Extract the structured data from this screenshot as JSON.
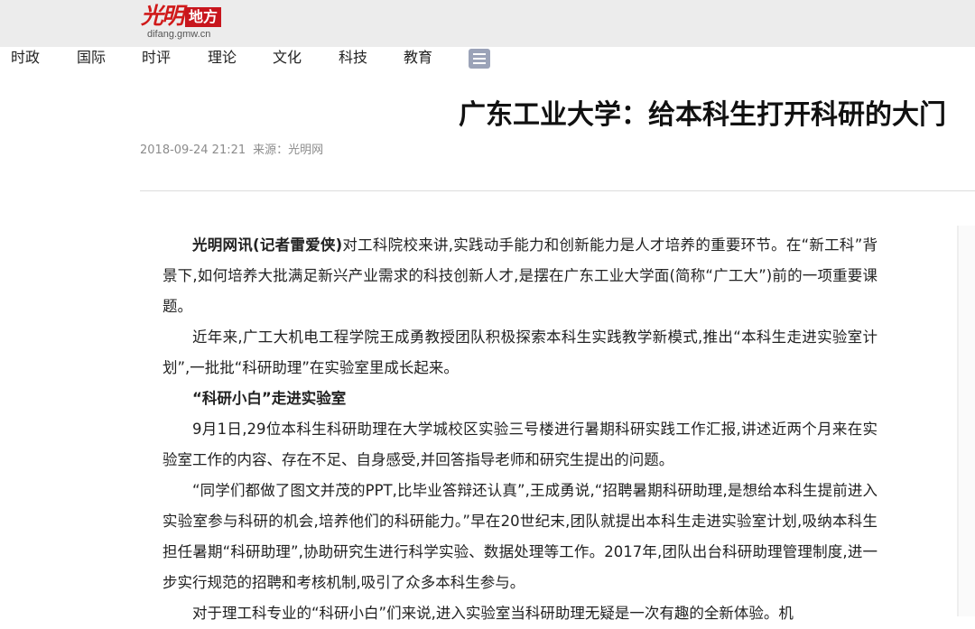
{
  "header": {
    "logo_script": "光明",
    "logo_box": "地方",
    "logo_url": "difang.gmw.cn"
  },
  "nav": {
    "items": [
      "时政",
      "国际",
      "时评",
      "理论",
      "文化",
      "科技",
      "教育"
    ],
    "menu_icon": "list-menu-icon"
  },
  "article": {
    "title": "广东工业大学：给本科生打开科研的大门",
    "date": "2018-09-24 21:21",
    "source": "来源：光明网",
    "lead": "光明网讯(记者雷爱侠)",
    "p1_rest": "对工科院校来讲,实践动手能力和创新能力是人才培养的重要环节。在“新工科”背景下,如何培养大批满足新兴产业需求的科技创新人才,是摆在广东工业大学面(简称“广工大”)前的一项重要课题。",
    "p2": "近年来,广工大机电工程学院王成勇教授团队积极探索本科生实践教学新模式,推出“本科生走进实验室计划”,一批批“科研助理”在实验室里成长起来。",
    "subheading": "“科研小白”走进实验室",
    "p3": "9月1日,29位本科生科研助理在大学城校区实验三号楼进行暑期科研实践工作汇报,讲述近两个月来在实验室工作的内容、存在不足、自身感受,并回答指导老师和研究生提出的问题。",
    "p4": "“同学们都做了图文并茂的PPT,比毕业答辩还认真”,王成勇说,“招聘暑期科研助理,是想给本科生提前进入实验室参与科研的机会,培养他们的科研能力。”早在20世纪末,团队就提出本科生走进实验室计划,吸纳本科生担任暑期“科研助理”,协助研究生进行科学实验、数据处理等工作。2017年,团队出台科研助理管理制度,进一步实行规范的招聘和考核机制,吸引了众多本科生参与。",
    "p5": "对于理工科专业的“科研小白”们来说,进入实验室当科研助理无疑是一次有趣的全新体验。机"
  }
}
